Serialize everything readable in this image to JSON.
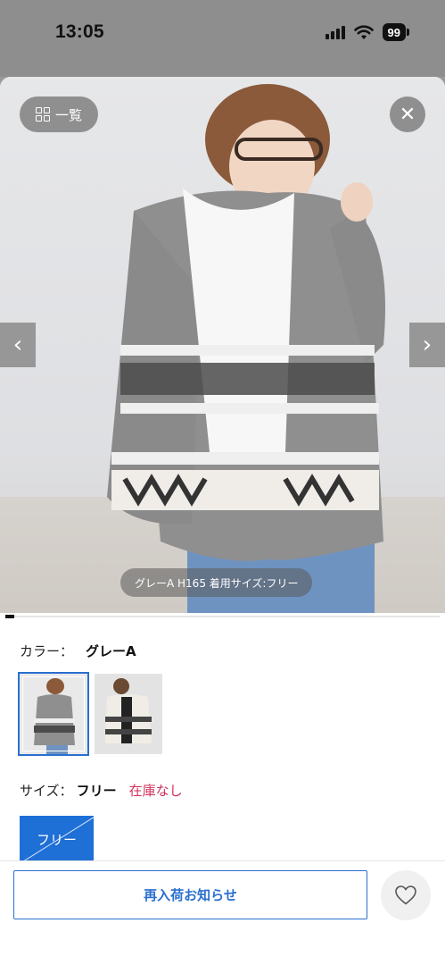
{
  "status_bar": {
    "time": "13:05",
    "battery": "99"
  },
  "gallery": {
    "list_button_label": "一覧",
    "caption": "グレーA H165 着用サイズ:フリー",
    "progress": 0.02
  },
  "color": {
    "label": "カラー：",
    "value": "グレーA"
  },
  "size": {
    "label": "サイズ：",
    "value": "フリー",
    "stock": "在庫なし",
    "chip_label": "フリー"
  },
  "actions": {
    "notify_label": "再入荷お知らせ"
  },
  "colors": {
    "accent": "#2a6fcf",
    "chip": "#1e6fd6",
    "out_of_stock": "#d0305a"
  },
  "icons": {
    "list": "grid-icon",
    "close": "close-icon",
    "prev": "chevron-left-icon",
    "next": "chevron-right-icon",
    "favorite": "heart-icon"
  }
}
